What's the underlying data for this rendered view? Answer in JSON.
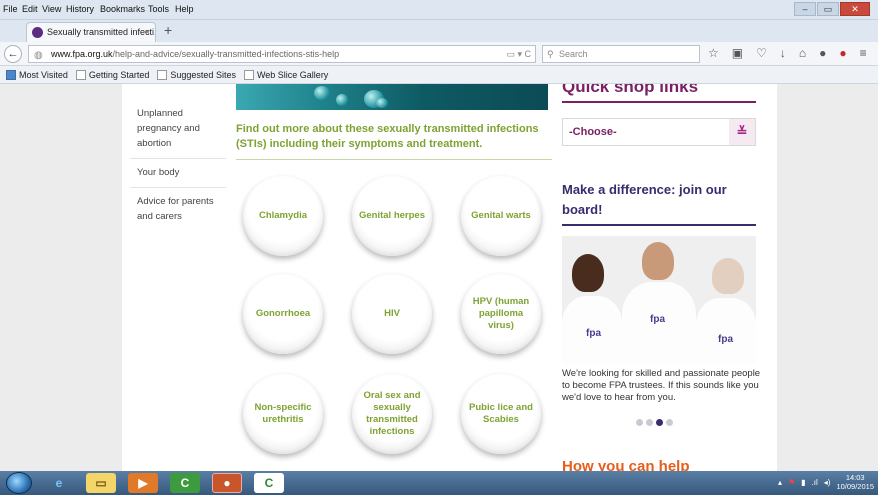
{
  "menubar": {
    "items": [
      "File",
      "Edit",
      "View",
      "History",
      "Bookmarks",
      "Tools",
      "Help"
    ],
    "underline": [
      "F",
      "E",
      "V",
      "s",
      "B",
      "T",
      "H"
    ]
  },
  "tab": {
    "title": "Sexually transmitted infecti...",
    "close": "×",
    "newtab": "+"
  },
  "nav": {
    "back": "←",
    "url_host": "www.fpa.org.uk",
    "url_path": "/help-and-advice/sexually-transmitted-infections-stis-help",
    "url_tools": "▭ ▾ C",
    "search_placeholder": "Search"
  },
  "toolbar_icons": [
    "star-icon",
    "clipboard-icon",
    "pocket-icon",
    "download-icon",
    "home-icon",
    "chat-icon",
    "pinterest-icon",
    "menu-icon"
  ],
  "toolbar_glyphs": [
    "☆",
    "▣",
    "♡",
    "↓",
    "⌂",
    "●",
    "●",
    "≡"
  ],
  "bookmarks": [
    "Most Visited",
    "Getting Started",
    "Suggested Sites",
    "Web Slice Gallery"
  ],
  "sidebar_nav": [
    "Unplanned pregnancy and abortion",
    "Your body",
    "Advice for parents and carers"
  ],
  "intro_text": "Find out more about these sexually transmitted infections (STIs) including their symptoms and treatment.",
  "topics": [
    "Chlamydia",
    "Genital herpes",
    "Genital warts",
    "Gonorrhoea",
    "HIV",
    "HPV (human papilloma virus)",
    "Non-specific urethritis",
    "Oral sex and sexually transmitted infections",
    "Pubic lice and Scabies"
  ],
  "quick_shop": {
    "title": "Quick shop links",
    "select_value": "-Choose-",
    "chevron": "≚"
  },
  "make_difference": {
    "title": "Make a difference: join our board!",
    "logo": "fpa",
    "text": "We're looking for skilled and passionate people to become FPA trustees. If this sounds like you we'd love to hear from you.",
    "dots_total": 4,
    "dots_active": 2
  },
  "how_you_can_help": "How you can help",
  "tray": {
    "time": "14:03",
    "date": "10/09/2015"
  },
  "colors": {
    "green": "#7ea332",
    "plum": "#7a1f63",
    "navy": "#3a2a6e",
    "orange": "#e55e1b"
  }
}
